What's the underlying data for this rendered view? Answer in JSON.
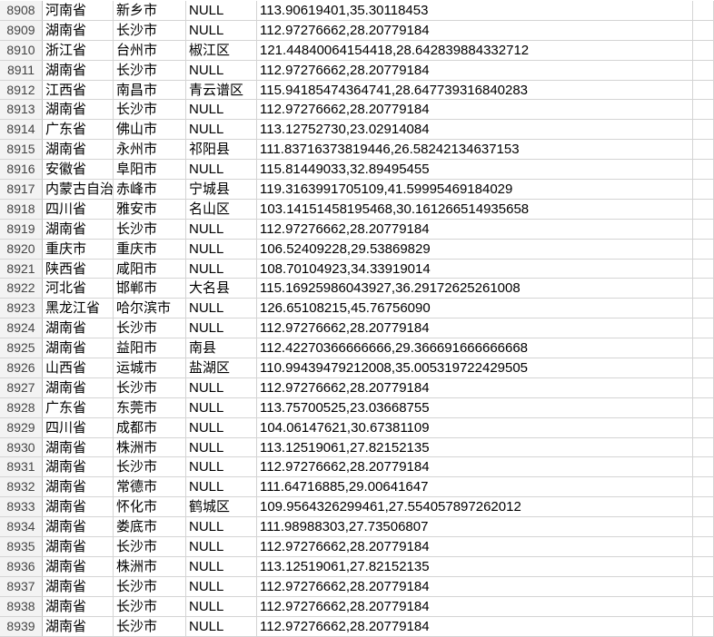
{
  "rows": [
    {
      "n": "8908",
      "province": "河南省",
      "city": "新乡市",
      "district": "NULL",
      "coords": "113.90619401,35.30118453"
    },
    {
      "n": "8909",
      "province": "湖南省",
      "city": "长沙市",
      "district": "NULL",
      "coords": "112.97276662,28.20779184"
    },
    {
      "n": "8910",
      "province": "浙江省",
      "city": "台州市",
      "district": "椒江区",
      "coords": "121.44840064154418,28.642839884332712"
    },
    {
      "n": "8911",
      "province": "湖南省",
      "city": "长沙市",
      "district": "NULL",
      "coords": "112.97276662,28.20779184"
    },
    {
      "n": "8912",
      "province": "江西省",
      "city": "南昌市",
      "district": "青云谱区",
      "coords": "115.94185474364741,28.647739316840283"
    },
    {
      "n": "8913",
      "province": "湖南省",
      "city": "长沙市",
      "district": "NULL",
      "coords": "112.97276662,28.20779184"
    },
    {
      "n": "8914",
      "province": "广东省",
      "city": "佛山市",
      "district": "NULL",
      "coords": "113.12752730,23.02914084"
    },
    {
      "n": "8915",
      "province": "湖南省",
      "city": "永州市",
      "district": "祁阳县",
      "coords": "111.83716373819446,26.58242134637153"
    },
    {
      "n": "8916",
      "province": "安徽省",
      "city": "阜阳市",
      "district": "NULL",
      "coords": "115.81449033,32.89495455"
    },
    {
      "n": "8917",
      "province": "内蒙古自治",
      "city": "赤峰市",
      "district": "宁城县",
      "coords": "119.3163991705109,41.59995469184029"
    },
    {
      "n": "8918",
      "province": "四川省",
      "city": "雅安市",
      "district": "名山区",
      "coords": "103.14151458195468,30.161266514935658"
    },
    {
      "n": "8919",
      "province": "湖南省",
      "city": "长沙市",
      "district": "NULL",
      "coords": "112.97276662,28.20779184"
    },
    {
      "n": "8920",
      "province": "重庆市",
      "city": "重庆市",
      "district": "NULL",
      "coords": "106.52409228,29.53869829"
    },
    {
      "n": "8921",
      "province": "陕西省",
      "city": "咸阳市",
      "district": "NULL",
      "coords": "108.70104923,34.33919014"
    },
    {
      "n": "8922",
      "province": "河北省",
      "city": "邯郸市",
      "district": "大名县",
      "coords": "115.16925986043927,36.29172625261008"
    },
    {
      "n": "8923",
      "province": "黑龙江省",
      "city": "哈尔滨市",
      "district": "NULL",
      "coords": "126.65108215,45.76756090"
    },
    {
      "n": "8924",
      "province": "湖南省",
      "city": "长沙市",
      "district": "NULL",
      "coords": "112.97276662,28.20779184"
    },
    {
      "n": "8925",
      "province": "湖南省",
      "city": "益阳市",
      "district": "南县",
      "coords": "112.42270366666666,29.366691666666668"
    },
    {
      "n": "8926",
      "province": "山西省",
      "city": "运城市",
      "district": "盐湖区",
      "coords": "110.99439479212008,35.005319722429505"
    },
    {
      "n": "8927",
      "province": "湖南省",
      "city": "长沙市",
      "district": "NULL",
      "coords": "112.97276662,28.20779184"
    },
    {
      "n": "8928",
      "province": "广东省",
      "city": "东莞市",
      "district": "NULL",
      "coords": "113.75700525,23.03668755"
    },
    {
      "n": "8929",
      "province": "四川省",
      "city": "成都市",
      "district": "NULL",
      "coords": "104.06147621,30.67381109"
    },
    {
      "n": "8930",
      "province": "湖南省",
      "city": "株洲市",
      "district": "NULL",
      "coords": "113.12519061,27.82152135"
    },
    {
      "n": "8931",
      "province": "湖南省",
      "city": "长沙市",
      "district": "NULL",
      "coords": "112.97276662,28.20779184"
    },
    {
      "n": "8932",
      "province": "湖南省",
      "city": "常德市",
      "district": "NULL",
      "coords": "111.64716885,29.00641647"
    },
    {
      "n": "8933",
      "province": "湖南省",
      "city": "怀化市",
      "district": "鹤城区",
      "coords": "109.9564326299461,27.554057897262012"
    },
    {
      "n": "8934",
      "province": "湖南省",
      "city": "娄底市",
      "district": "NULL",
      "coords": "111.98988303,27.73506807"
    },
    {
      "n": "8935",
      "province": "湖南省",
      "city": "长沙市",
      "district": "NULL",
      "coords": "112.97276662,28.20779184"
    },
    {
      "n": "8936",
      "province": "湖南省",
      "city": "株洲市",
      "district": "NULL",
      "coords": "113.12519061,27.82152135"
    },
    {
      "n": "8937",
      "province": "湖南省",
      "city": "长沙市",
      "district": "NULL",
      "coords": "112.97276662,28.20779184"
    },
    {
      "n": "8938",
      "province": "湖南省",
      "city": "长沙市",
      "district": "NULL",
      "coords": "112.97276662,28.20779184"
    },
    {
      "n": "8939",
      "province": "湖南省",
      "city": "长沙市",
      "district": "NULL",
      "coords": "112.97276662,28.20779184"
    }
  ]
}
